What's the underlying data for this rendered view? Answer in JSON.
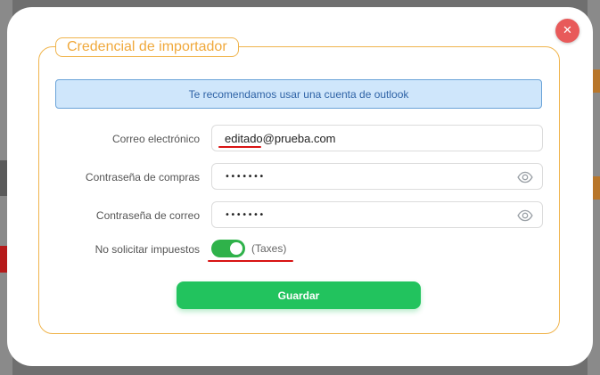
{
  "modal": {
    "legend": "Credencial de importador",
    "close_icon": "close-icon",
    "info_message": "Te recomendamos usar una cuenta de outlook",
    "fields": {
      "email": {
        "label": "Correo electrónico",
        "value": "editado@prueba.com"
      },
      "purchase_password": {
        "label": "Contraseña de compras",
        "value": "•••••••",
        "icon": "eye-icon"
      },
      "email_password": {
        "label": "Contraseña de correo",
        "value": "•••••••",
        "icon": "eye-icon"
      },
      "no_taxes": {
        "label": "No solicitar impuestos",
        "toggle_on": true,
        "hint": "(Taxes)"
      }
    },
    "save_label": "Guardar"
  },
  "colors": {
    "accent_orange": "#f0b44c",
    "save_green": "#22c35e",
    "toggle_green": "#2fb24a",
    "info_bg": "#cfe6fb",
    "info_text": "#2f63a6",
    "close_red": "#e85a5a",
    "annotation_red": "#d81313"
  }
}
